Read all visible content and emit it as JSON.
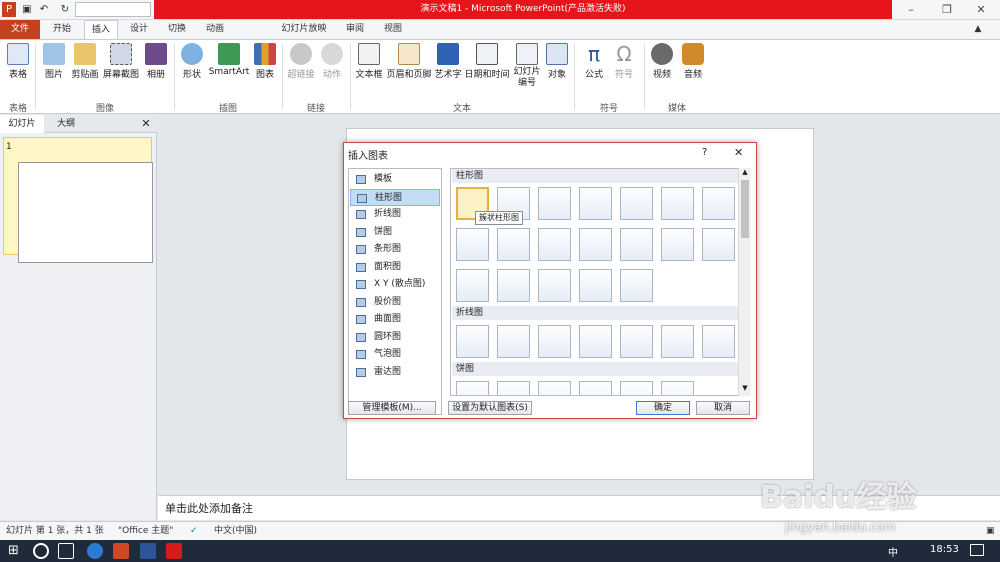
{
  "title": "演示文稿1 - Microsoft PowerPoint(产品激活失败)",
  "tabs": [
    "文件",
    "开始",
    "插入",
    "设计",
    "切换",
    "动画",
    "幻灯片放映",
    "审阅",
    "视图"
  ],
  "ribbon": {
    "buttons": [
      "表格",
      "图片",
      "剪贴画",
      "屏幕截图",
      "相册",
      "形状",
      "SmartArt",
      "图表",
      "超链接",
      "动作",
      "文本框",
      "页眉和页脚",
      "艺术字",
      "日期和时间",
      "幻灯片编号",
      "对象",
      "公式",
      "符号",
      "视频",
      "音频"
    ],
    "groups": [
      "表格",
      "图像",
      "插图",
      "链接",
      "文本",
      "符号",
      "媒体"
    ]
  },
  "left_pane": {
    "tabs": [
      "幻灯片",
      "大纲"
    ],
    "slide_number": "1"
  },
  "notes_placeholder": "单击此处添加备注",
  "status": {
    "slide": "幻灯片 第 1 张，共 1 张",
    "theme": "\"Office 主题\"",
    "language": "中文(中国)"
  },
  "dialog": {
    "title": "插入图表",
    "help": "?",
    "close": "✕",
    "categories": [
      "模板",
      "柱形图",
      "折线图",
      "饼图",
      "条形图",
      "面积图",
      "X Y (散点图)",
      "股价图",
      "曲面图",
      "圆环图",
      "气泡图",
      "雷达图"
    ],
    "selected_category": "柱形图",
    "sections": [
      "柱形图",
      "折线图",
      "饼图"
    ],
    "tooltip": "簇状柱形图",
    "manage_button": "管理模板(M)...",
    "default_button": "设置为默认图表(S)",
    "ok_button": "确定",
    "cancel_button": "取消"
  },
  "taskbar": {
    "time": "18:53",
    "ime": "中"
  },
  "watermark": {
    "brand": "Baidu经验",
    "url": "jingyan.baidu.com"
  },
  "colors": {
    "accent_red": "#e8141b",
    "file_tab": "#c4401f",
    "dialog_border": "#c24a4a"
  }
}
